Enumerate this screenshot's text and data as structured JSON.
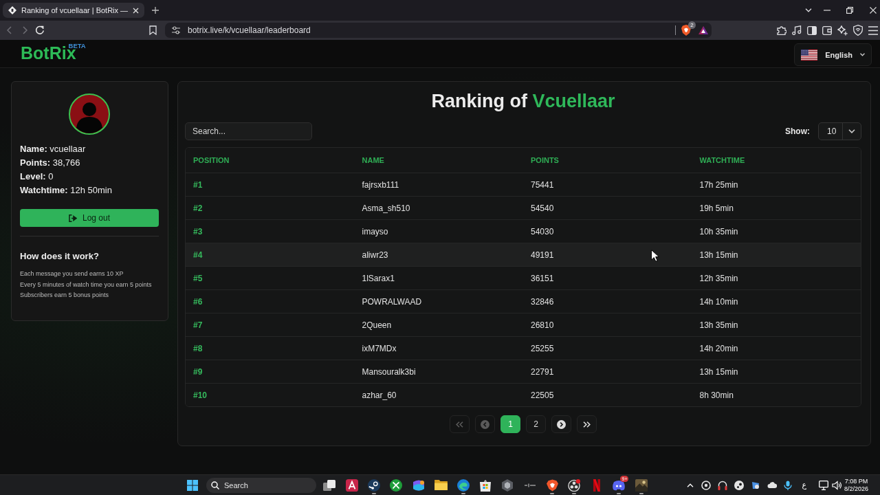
{
  "browser": {
    "tab_title": "Ranking of vcuellaar | BotRix —",
    "address": "botrix.live/k/vcuellaar/leaderboard",
    "shield_count": "2"
  },
  "header": {
    "logo": "BotRix",
    "logo_tag": "BETA",
    "language": "English"
  },
  "profile": {
    "details": [
      "**Name:** vcuellaar",
      "**Points:** 38,766",
      "**Level:** 0",
      "**Watchtime:** 12h 50min"
    ],
    "logout": "Log out",
    "help_title": "How does it work?",
    "help_lines": [
      "Each message you send earns 10 XP",
      "Every 5 minutes of watch time you earn 5 points",
      "Subscribers earn 5 bonus points"
    ]
  },
  "leaderboard": {
    "title": "Ranking of",
    "title_name": "Vcuellaar",
    "search": {
      "placeholder": "Search..."
    },
    "show_label": "Show:",
    "show_value": "10",
    "table": {
      "columns": [
        "POSITION",
        "NAME",
        "POINTS",
        "WATCHTIME"
      ],
      "rows": [
        {
          "cells": [
            "#1",
            "fajrsxb111",
            "75441",
            "17h 25min"
          ],
          "highlighted": false
        },
        {
          "cells": [
            "#2",
            "Asma_sh510",
            "54540",
            "19h 5min"
          ],
          "highlighted": false
        },
        {
          "cells": [
            "#3",
            "imayso",
            "54030",
            "10h 35min"
          ],
          "highlighted": false
        },
        {
          "cells": [
            "#4",
            "aliwr23",
            "49191",
            "13h 15min"
          ],
          "highlighted": true
        },
        {
          "cells": [
            "#5",
            "1lSarax1",
            "36151",
            "12h 35min"
          ],
          "highlighted": false
        },
        {
          "cells": [
            "#6",
            "POWRALWAAD",
            "32846",
            "14h 10min"
          ],
          "highlighted": false
        },
        {
          "cells": [
            "#7",
            "2Queen",
            "26810",
            "13h 35min"
          ],
          "highlighted": false
        },
        {
          "cells": [
            "#8",
            "ixM7MDx",
            "25255",
            "14h 20min"
          ],
          "highlighted": false
        },
        {
          "cells": [
            "#9",
            "Mansouralk3bi",
            "22791",
            "13h 15min"
          ],
          "highlighted": false
        },
        {
          "cells": [
            "#10",
            "azhar_60",
            "22505",
            "8h 30min"
          ],
          "highlighted": false
        }
      ]
    },
    "pagination": [
      {
        "kind": "first",
        "selected": false,
        "disabled": true
      },
      {
        "kind": "previous",
        "selected": false,
        "disabled": true
      },
      {
        "kind": "page",
        "label": "1",
        "selected": true,
        "disabled": false
      },
      {
        "kind": "page",
        "label": "2",
        "selected": false,
        "disabled": false
      },
      {
        "kind": "next",
        "selected": false,
        "disabled": false
      },
      {
        "kind": "last",
        "selected": false,
        "disabled": false
      }
    ]
  },
  "taskbar": {
    "search": {
      "placeholder": "Search"
    },
    "apps": [
      {
        "kind": "taskview",
        "running": false
      },
      {
        "kind": "design",
        "running": false
      },
      {
        "kind": "steam",
        "running": true
      },
      {
        "kind": "xbox",
        "running": false
      },
      {
        "kind": "copilot",
        "running": false
      },
      {
        "kind": "files",
        "running": false
      },
      {
        "kind": "edge",
        "running": true
      },
      {
        "kind": "store",
        "running": false
      },
      {
        "kind": "hexagon",
        "running": false
      },
      {
        "kind": "sio",
        "running": false
      },
      {
        "kind": "brave",
        "running": true
      },
      {
        "kind": "obs",
        "running": true
      },
      {
        "kind": "netflix",
        "running": false
      },
      {
        "kind": "discord",
        "running": true,
        "badge": "9+"
      },
      {
        "kind": "game",
        "running": true
      }
    ],
    "keyboard_layout": "ع",
    "time": "7:08 PM",
    "date": "8/2/2026"
  }
}
